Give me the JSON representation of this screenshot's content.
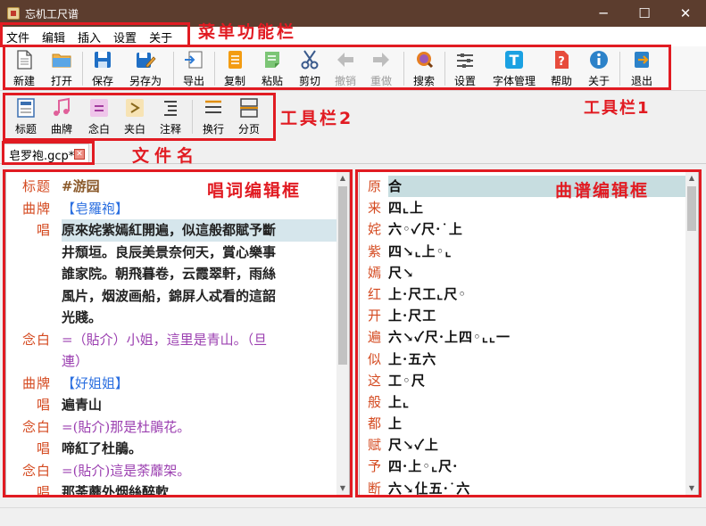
{
  "window": {
    "title": "忘机工尺谱",
    "minimize": "─",
    "maximize": "☐",
    "close": "✕"
  },
  "menu": [
    "文件",
    "编辑",
    "插入",
    "设置",
    "关于"
  ],
  "toolbar1": [
    {
      "label": "新建",
      "icon": "new-file-icon"
    },
    {
      "label": "打开",
      "icon": "open-folder-icon"
    },
    {
      "label": "保存",
      "icon": "save-icon"
    },
    {
      "label": "另存为",
      "icon": "save-as-icon"
    },
    {
      "label": "导出",
      "icon": "export-icon"
    },
    {
      "label": "复制",
      "icon": "copy-icon"
    },
    {
      "label": "粘贴",
      "icon": "paste-icon"
    },
    {
      "label": "剪切",
      "icon": "scissors-icon"
    },
    {
      "label": "撤销",
      "icon": "undo-icon",
      "disabled": true
    },
    {
      "label": "重做",
      "icon": "redo-icon",
      "disabled": true
    },
    {
      "label": "搜索",
      "icon": "search-icon"
    },
    {
      "label": "设置",
      "icon": "settings-icon"
    },
    {
      "label": "字体管理",
      "icon": "font-icon"
    },
    {
      "label": "帮助",
      "icon": "help-icon"
    },
    {
      "label": "关于",
      "icon": "info-icon"
    },
    {
      "label": "退出",
      "icon": "exit-icon"
    }
  ],
  "toolbar2": [
    {
      "label": "标题",
      "icon": "title-icon"
    },
    {
      "label": "曲牌",
      "icon": "music-note-icon"
    },
    {
      "label": "念白",
      "icon": "equals-icon"
    },
    {
      "label": "夹白",
      "icon": "angle-icon"
    },
    {
      "label": "注释",
      "icon": "list-icon"
    },
    {
      "label": "换行",
      "icon": "line-break-icon"
    },
    {
      "label": "分页",
      "icon": "page-break-icon"
    }
  ],
  "file_tab": {
    "name": "皂罗袍.gcp*",
    "close": "✕"
  },
  "annotations": {
    "menu": "菜单功能栏",
    "toolbar1": "工具栏1",
    "toolbar2": "工具栏2",
    "filename": "文件名",
    "lyric": "唱词编辑框",
    "score": "曲谱编辑框"
  },
  "lyric_rows": [
    {
      "tag": "标题",
      "text": "#游园",
      "kind": "title"
    },
    {
      "tag": "曲牌",
      "text": "【皂羅袍】",
      "kind": "qupai"
    },
    {
      "tag": "唱",
      "text": "原來姹紫嫣紅開遍，似這般都賦予斷",
      "kind": "chang",
      "hl": true
    },
    {
      "tag": "",
      "text": "井頹垣。良辰美景奈何天，賞心樂事",
      "kind": "chang"
    },
    {
      "tag": "",
      "text": "誰家院。朝飛暮卷，云霞翠軒，雨絲",
      "kind": "chang"
    },
    {
      "tag": "",
      "text": "風片，烟波画船，錦屏人忒看的這韶",
      "kind": "chang"
    },
    {
      "tag": "",
      "text": "光賤。",
      "kind": "chang"
    },
    {
      "tag": "念白",
      "text": "=（貼介）小姐，這里是青山。（旦",
      "kind": "nianbai"
    },
    {
      "tag": "",
      "text": "連）",
      "kind": "nianbai"
    },
    {
      "tag": "曲牌",
      "text": "【好姐姐】",
      "kind": "qupai"
    },
    {
      "tag": "唱",
      "text": "遍青山",
      "kind": "chang"
    },
    {
      "tag": "念白",
      "text": "=(貼介)那是杜鵑花。",
      "kind": "nianbai"
    },
    {
      "tag": "唱",
      "text": "啼紅了杜鵑。",
      "kind": "chang"
    },
    {
      "tag": "念白",
      "text": "=(貼介)這是荼蘼架。",
      "kind": "nianbai"
    },
    {
      "tag": "唱",
      "text": "那荼蘼外烟絲醉軟",
      "kind": "chang"
    }
  ],
  "score_rows": [
    {
      "ch": "原",
      "notes": "合",
      "hl": true
    },
    {
      "ch": "来",
      "notes": "四⌞上"
    },
    {
      "ch": "姹",
      "notes": "六◦✓尺·˙上"
    },
    {
      "ch": "紫",
      "notes": "四↘⌞上◦⌞"
    },
    {
      "ch": "嫣",
      "notes": "尺↘"
    },
    {
      "ch": "红",
      "notes": "上·尺工⌞尺◦"
    },
    {
      "ch": "开",
      "notes": "上·尺工"
    },
    {
      "ch": "遍",
      "notes": "六↘✓尺·上四◦⌞⌞一"
    },
    {
      "ch": "似",
      "notes": "上·五六"
    },
    {
      "ch": "这",
      "notes": "工◦尺"
    },
    {
      "ch": "般",
      "notes": "上⌞"
    },
    {
      "ch": "都",
      "notes": "上"
    },
    {
      "ch": "赋",
      "notes": "尺↘✓上"
    },
    {
      "ch": "予",
      "notes": "四·上◦⌞尺·"
    },
    {
      "ch": "断",
      "notes": "六↘仩五·˙六"
    }
  ]
}
